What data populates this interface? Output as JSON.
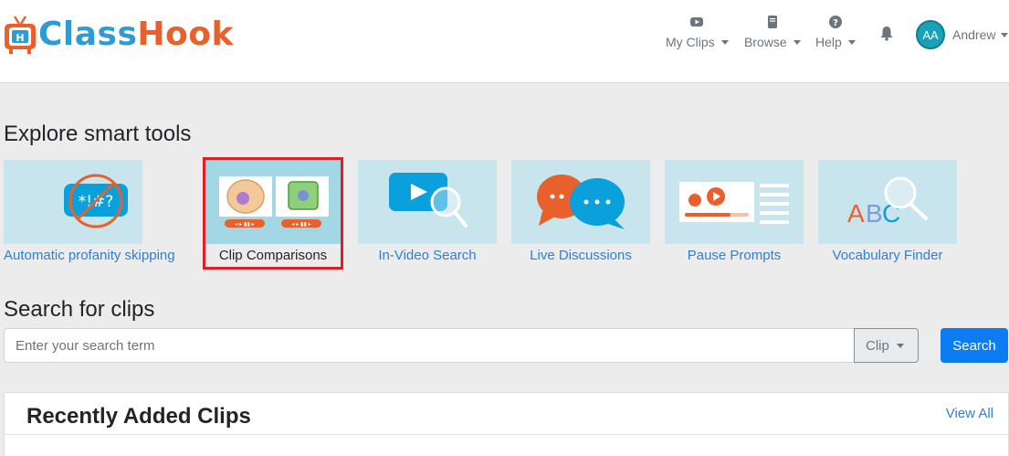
{
  "brand": {
    "name_part1": "Class",
    "name_part2": "Hook"
  },
  "nav": {
    "my_clips": "My Clips",
    "browse": "Browse",
    "help": "Help",
    "user_initials": "AA",
    "user_name": "Andrew"
  },
  "smart_tools": {
    "title": "Explore smart tools",
    "items": [
      {
        "label": "Automatic profanity skipping",
        "icon": "profanity-bubble-icon"
      },
      {
        "label": "Clip Comparisons",
        "icon": "cell-comparison-icon",
        "highlighted": true
      },
      {
        "label": "In-Video Search",
        "icon": "video-search-icon"
      },
      {
        "label": "Live Discussions",
        "icon": "chat-bubbles-icon"
      },
      {
        "label": "Pause Prompts",
        "icon": "pause-prompt-icon"
      },
      {
        "label": "Vocabulary Finder",
        "icon": "abc-search-icon"
      }
    ]
  },
  "search": {
    "title": "Search for clips",
    "placeholder": "Enter your search term",
    "type_selected": "Clip",
    "button_label": "Search"
  },
  "recent": {
    "title": "Recently Added Clips",
    "view_all": "View All"
  },
  "colors": {
    "brand_orange": "#e8612c",
    "brand_blue": "#2f9bd6",
    "primary_button": "#0d7cf2",
    "link": "#2f7fd2",
    "highlight_border": "#e01e26",
    "avatar_bg": "#17a2b8"
  }
}
